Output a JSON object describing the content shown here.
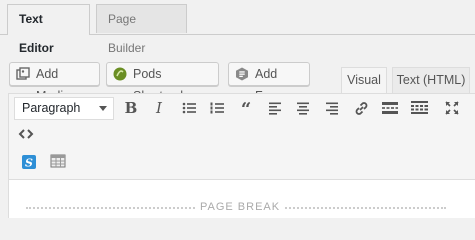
{
  "top_tabs": [
    {
      "label": "Text Editor"
    },
    {
      "label": "Page Builder"
    }
  ],
  "media_buttons": {
    "add_media": "Add Media",
    "pods_shortcode": "Pods Shortcode",
    "add_form": "Add Form"
  },
  "mode_tabs": {
    "visual": "Visual",
    "text": "Text (HTML)"
  },
  "toolbar": {
    "format_value": "Paragraph",
    "icons": [
      "bold-icon",
      "italic-icon",
      "bulleted-list-icon",
      "numbered-list-icon",
      "blockquote-icon",
      "align-left-icon",
      "align-center-icon",
      "align-right-icon",
      "link-icon",
      "read-more-icon",
      "toolbar-toggle-icon",
      "fullscreen-icon",
      "code-icon",
      "s-plugin-icon",
      "table-icon"
    ]
  },
  "content": {
    "page_break_label": "PAGE BREAK"
  },
  "colors": {
    "accent_blue": "#2e8fd6",
    "pods_green": "#6a8e23",
    "icon_gray": "#555555"
  }
}
